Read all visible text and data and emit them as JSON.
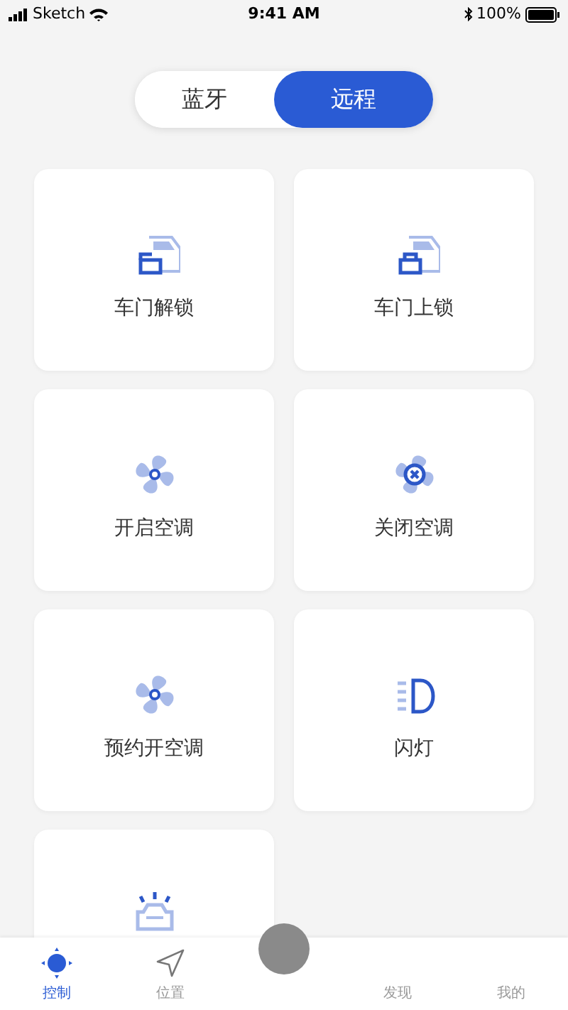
{
  "status_bar": {
    "carrier": "Sketch",
    "time": "9:41 AM",
    "battery": "100%"
  },
  "mode_tabs": [
    {
      "label": "蓝牙",
      "selected": false
    },
    {
      "label": "远程",
      "selected": true
    }
  ],
  "controls": [
    {
      "kind": "unlock",
      "label": "车门解锁"
    },
    {
      "kind": "lock",
      "label": "车门上锁"
    },
    {
      "kind": "fan",
      "label": "开启空调"
    },
    {
      "kind": "fan-off",
      "label": "关闭空调"
    },
    {
      "kind": "fan",
      "label": "预约开空调"
    },
    {
      "kind": "headlight",
      "label": "闪灯"
    },
    {
      "kind": "car-light"
    }
  ],
  "tab_bar": [
    {
      "kind": "control",
      "label": "控制",
      "selected": true
    },
    {
      "kind": "location",
      "label": "位置",
      "selected": false
    },
    {
      "kind": "center"
    },
    {
      "kind": "none",
      "label": "发现",
      "selected": false
    },
    {
      "kind": "none",
      "label": "我的",
      "selected": false
    }
  ]
}
